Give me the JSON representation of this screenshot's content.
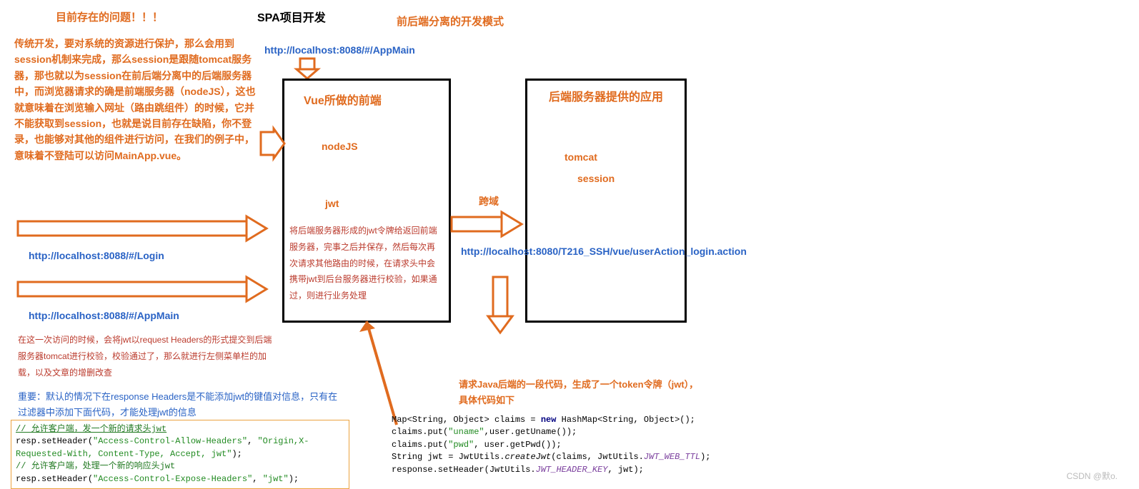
{
  "headings": {
    "problem": "目前存在的问题！！！",
    "spa": "SPA项目开发",
    "mode": "前后端分离的开发模式"
  },
  "leftParagraph": "传统开发，要对系统的资源进行保护，那么会用到session机制来完成，那么session是跟随tomcat服务器，那也就以为session在前后端分离中的后端服务器中，而浏览器请求的确是前端服务器（nodeJS），这也就意味着在浏览输入网址（路由跳组件）的时候，它并不能获取到session，也就是说目前存在缺陷，你不登录，也能够对其他的组件进行访问，在我们的例子中，意味着不登陆可以访问MainApp.vue。",
  "urls": {
    "appMainTop": "http://localhost:8088/#/AppMain",
    "login": "http://localhost:8088/#/Login",
    "appMainBottom": "http://localhost:8088/#/AppMain",
    "backend": "http://localhost:8080/T216_SSH/vue/userAction_login.action"
  },
  "cross": "跨域",
  "frontBox": {
    "title": "Vue所做的前端",
    "nodejs": "nodeJS",
    "jwt": "jwt",
    "desc": "将后端服务器形成的jwt令牌给返回前端服务器，完事之后并保存，然后每次再次请求其他路由的时候，在请求头中会携带jwt到后台服务器进行校验，如果通过，则进行业务处理"
  },
  "backBox": {
    "title": "后端服务器提供的应用",
    "tomcat": "tomcat",
    "session": "session"
  },
  "redNotes": {
    "visit": "在这一次访问的时候，会将jwt以request Headers的形式提交到后端服务器tomcat进行校验，校验通过了，那么就进行左侧菜单栏的加载，以及文章的增删改查"
  },
  "blueNote": "重要：默认的情况下在response Headers是不能添加jwt的键值对信息，只有在过滤器中添加下面代码，才能处理jwt的信息",
  "javaDesc": "请求Java后端的一段代码，生成了一个token令牌（jwt），具体代码如下",
  "code1": {
    "c1a": "// 允许客户端，发一个新的请求头jwt",
    "c2a": "resp.setHeader(",
    "c2b": "\"Access-Control-Allow-Headers\"",
    "c2c": ", ",
    "c2d": "\"Origin,X-Requested-With, Content-Type, Accept, jwt\"",
    "c2e": ");",
    "c3a": "// 允许客户端，处理一个新的响应头jwt",
    "c4a": "resp.setHeader(",
    "c4b": "\"Access-Control-Expose-Headers\"",
    "c4c": ", ",
    "c4d": "\"jwt\"",
    "c4e": ");"
  },
  "code2": {
    "l1a": "Map<String, Object> claims = ",
    "l1b": "new",
    "l1c": " HashMap<String, Object>();",
    "l2a": "claims.put(",
    "l2b": "\"uname\"",
    "l2c": ",user.getUname());",
    "l3a": "claims.put(",
    "l3b": "\"pwd\"",
    "l3c": ", user.getPwd());",
    "l4a": "String jwt = JwtUtils.",
    "l4b": "createJwt",
    "l4c": "(claims, JwtUtils.",
    "l4d": "JWT_WEB_TTL",
    "l4e": ");",
    "l5a": "response.setHeader(JwtUtils.",
    "l5b": "JWT_HEADER_KEY",
    "l5c": ", jwt);"
  },
  "watermark": "CSDN @默o."
}
